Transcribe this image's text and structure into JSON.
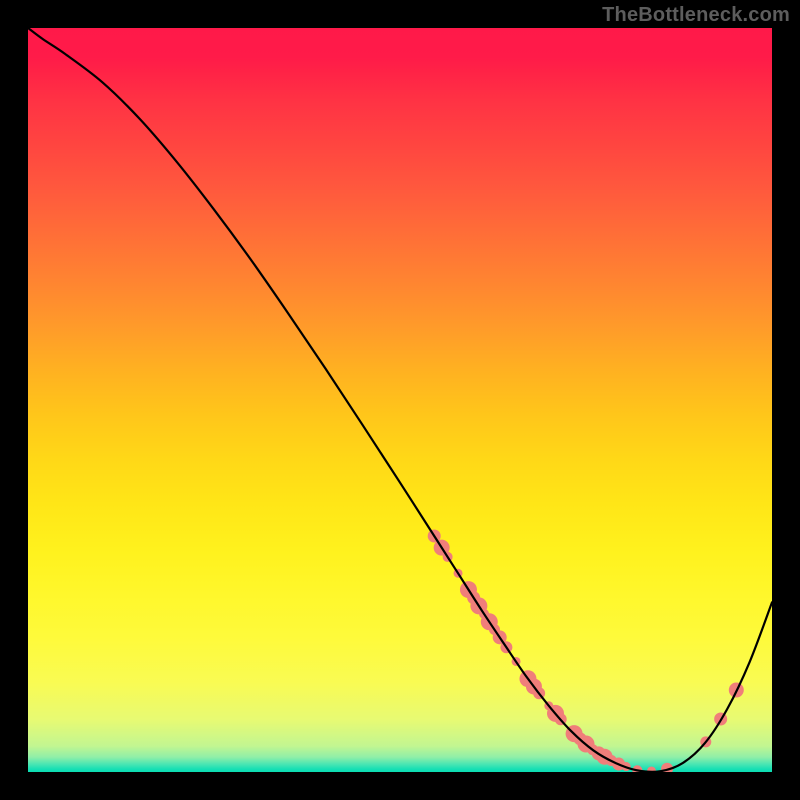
{
  "watermark": "TheBottleneck.com",
  "chart_data": {
    "type": "line",
    "title": "",
    "xlabel": "",
    "ylabel": "",
    "xlim": [
      0,
      100
    ],
    "ylim": [
      0,
      100
    ],
    "grid": false,
    "legend": false,
    "series": [
      {
        "name": "curve",
        "x": [
          0.0,
          2.0,
          5.0,
          10.0,
          15.0,
          20.0,
          25.0,
          30.0,
          35.0,
          40.0,
          45.0,
          50.0,
          55.0,
          58.0,
          61.0,
          64.0,
          67.0,
          70.0,
          73.0,
          76.0,
          79.0,
          82.0,
          85.0,
          88.0,
          91.0,
          94.0,
          97.0,
          100.0
        ],
        "values": [
          100.0,
          98.5,
          96.5,
          92.7,
          87.8,
          82.0,
          75.6,
          68.8,
          61.6,
          54.2,
          46.6,
          38.9,
          31.1,
          26.4,
          21.7,
          17.2,
          12.8,
          8.9,
          5.5,
          2.9,
          1.2,
          0.2,
          0.1,
          1.2,
          3.9,
          8.5,
          14.8,
          22.8
        ]
      }
    ],
    "scatter_points": {
      "name": "markers",
      "points": [
        {
          "x": 54.6,
          "r": 6.5
        },
        {
          "x": 55.6,
          "r": 8.0
        },
        {
          "x": 56.4,
          "r": 5.0
        },
        {
          "x": 57.8,
          "r": 4.5
        },
        {
          "x": 59.2,
          "r": 8.5
        },
        {
          "x": 59.9,
          "r": 6.5
        },
        {
          "x": 60.6,
          "r": 8.5
        },
        {
          "x": 61.3,
          "r": 5.0
        },
        {
          "x": 62.0,
          "r": 8.5
        },
        {
          "x": 62.7,
          "r": 5.5
        },
        {
          "x": 63.4,
          "r": 7.0
        },
        {
          "x": 64.3,
          "r": 6.0
        },
        {
          "x": 65.6,
          "r": 4.5
        },
        {
          "x": 67.2,
          "r": 8.5
        },
        {
          "x": 68.0,
          "r": 8.0
        },
        {
          "x": 68.7,
          "r": 6.0
        },
        {
          "x": 70.0,
          "r": 4.5
        },
        {
          "x": 70.9,
          "r": 8.5
        },
        {
          "x": 71.6,
          "r": 6.0
        },
        {
          "x": 73.4,
          "r": 8.5
        },
        {
          "x": 74.2,
          "r": 6.5
        },
        {
          "x": 75.0,
          "r": 8.5
        },
        {
          "x": 75.9,
          "r": 5.5
        },
        {
          "x": 76.7,
          "r": 7.0
        },
        {
          "x": 77.5,
          "r": 8.0
        },
        {
          "x": 78.4,
          "r": 5.5
        },
        {
          "x": 79.4,
          "r": 6.5
        },
        {
          "x": 80.4,
          "r": 4.5
        },
        {
          "x": 81.9,
          "r": 5.0
        },
        {
          "x": 83.8,
          "r": 4.5
        },
        {
          "x": 85.9,
          "r": 6.0
        },
        {
          "x": 91.1,
          "r": 5.5
        },
        {
          "x": 93.1,
          "r": 6.5
        },
        {
          "x": 95.2,
          "r": 7.5
        }
      ],
      "color": "#f07e7a"
    },
    "background_gradient": {
      "stops": [
        {
          "pos": 0.0,
          "color": "#ff1949"
        },
        {
          "pos": 0.5,
          "color": "#ffc01d"
        },
        {
          "pos": 0.82,
          "color": "#fefa3b"
        },
        {
          "pos": 0.96,
          "color": "#c2f691"
        },
        {
          "pos": 1.0,
          "color": "#0bddb3"
        }
      ]
    }
  },
  "colors": {
    "background": "#000000",
    "line": "#000000",
    "marker": "#f07e7a",
    "watermark": "#5d5d5d"
  }
}
